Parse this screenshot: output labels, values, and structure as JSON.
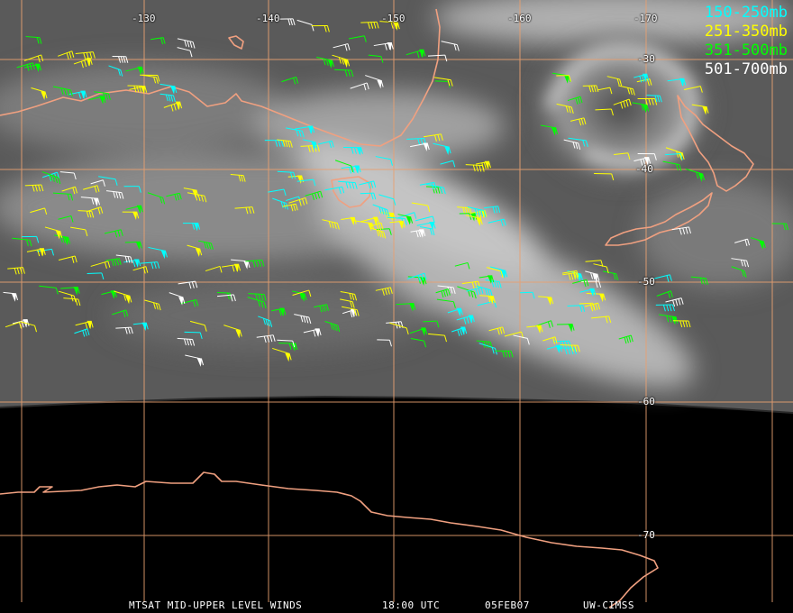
{
  "legend": [
    {
      "label": "150-250mb",
      "color": "#00ffff"
    },
    {
      "label": "251-350mb",
      "color": "#ffff00"
    },
    {
      "label": "351-500mb",
      "color": "#00ff00"
    },
    {
      "label": "501-700mb",
      "color": "#ffffff"
    }
  ],
  "longitude_labels": [
    "-130",
    "-140",
    "-150",
    "-160",
    "-170"
  ],
  "latitude_labels": [
    "-30",
    "-40",
    "-50",
    "-60",
    "-70"
  ],
  "footer": {
    "title": "MTSAT MID-UPPER LEVEL WINDS",
    "time": "18:00 UTC",
    "date": "05FEB07",
    "source": "UW-CIMSS"
  },
  "colors": {
    "coastline": "#f0a080",
    "gridline": "#e8a070",
    "background": "#000000"
  }
}
